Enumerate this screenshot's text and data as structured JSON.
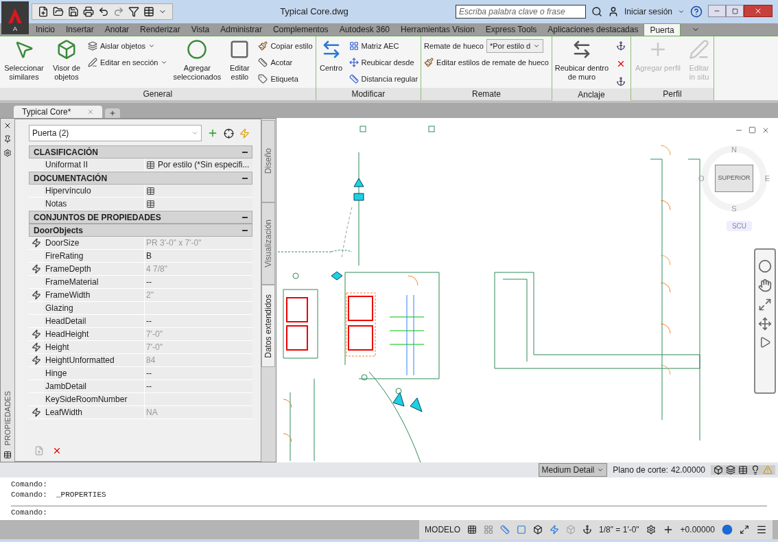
{
  "title_bar": {
    "app_button": "A",
    "title": "Typical Core.dwg",
    "search": {
      "placeholder": "Escriba palabra clave o frase"
    },
    "sign_in": "Iniciar sesión"
  },
  "ribbon_tabs": [
    {
      "label": "Inicio",
      "selected": false
    },
    {
      "label": "Insertar",
      "selected": false
    },
    {
      "label": "Anotar",
      "selected": false
    },
    {
      "label": "Renderizar",
      "selected": false
    },
    {
      "label": "Vista",
      "selected": false
    },
    {
      "label": "Administrar",
      "selected": false
    },
    {
      "label": "Complementos",
      "selected": false
    },
    {
      "label": "Autodesk 360",
      "selected": false
    },
    {
      "label": "Herramientas Vision",
      "selected": false
    },
    {
      "label": "Express Tools",
      "selected": false
    },
    {
      "label": "Aplicaciones destacadas",
      "selected": false
    },
    {
      "label": "Puerta",
      "selected": true
    }
  ],
  "ribbon_panels": [
    {
      "title": "General",
      "groups": [
        {
          "kind": "large",
          "items": [
            {
              "label": "Seleccionar similares",
              "disabled": false
            }
          ]
        },
        {
          "kind": "large",
          "items": [
            {
              "label": "Visor de objetos",
              "disabled": false
            }
          ]
        },
        {
          "kind": "small",
          "items": [
            {
              "label": "Aislar objetos",
              "dropdown": true
            },
            {
              "label": "Editar en sección",
              "dropdown": true
            }
          ]
        },
        {
          "kind": "large",
          "items": [
            {
              "label": "Agregar seleccionados",
              "disabled": false
            }
          ]
        },
        {
          "kind": "large",
          "items": [
            {
              "label": "Editar estilo",
              "disabled": false
            }
          ]
        },
        {
          "kind": "small",
          "items": [
            {
              "label": "Copiar estilo",
              "dropdown": false
            },
            {
              "label": "Acotar",
              "dropdown": false
            },
            {
              "label": "Etiqueta",
              "dropdown": false
            }
          ]
        }
      ]
    },
    {
      "title": "Modificar",
      "groups": [
        {
          "kind": "large",
          "items": [
            {
              "label": "Centro",
              "disabled": false
            }
          ]
        },
        {
          "kind": "small",
          "items": [
            {
              "label": "Matriz AEC",
              "dropdown": false
            },
            {
              "label": "Reubicar desde",
              "dropdown": false
            },
            {
              "label": "Distancia regular",
              "dropdown": false
            }
          ]
        }
      ]
    },
    {
      "title": "Remate",
      "groups": [
        {
          "kind": "combo",
          "label": "Remate de hueco",
          "value": "*Por estilo d",
          "items": [
            {
              "label": "Editar estilos de remate de hueco"
            }
          ]
        }
      ]
    },
    {
      "title": "Anclaje",
      "groups": [
        {
          "kind": "large",
          "items": [
            {
              "label": "Reubicar dentro de muro",
              "disabled": false
            }
          ]
        },
        {
          "kind": "icons",
          "items": [
            {
              "kind": "anchor"
            },
            {
              "kind": "remove"
            },
            {
              "kind": "link"
            }
          ]
        }
      ]
    },
    {
      "title": "Perfil",
      "groups": [
        {
          "kind": "large",
          "items": [
            {
              "label": "Agregar perfil",
              "disabled": true
            }
          ]
        },
        {
          "kind": "large",
          "items": [
            {
              "label": "Editar in situ",
              "disabled": true
            }
          ]
        }
      ]
    }
  ],
  "document_tabs": [
    {
      "label": "Typical Core*",
      "selected": true
    }
  ],
  "properties": {
    "palette_title": "PROPIEDADES",
    "selector": "Puerta (2)",
    "side_tabs": [
      {
        "label": "Diseño",
        "selected": false
      },
      {
        "label": "Visualización",
        "selected": false
      },
      {
        "label": "Datos extendidos",
        "selected": true
      }
    ],
    "sections": [
      {
        "title": "CLASIFICACIÓN",
        "expanded": true,
        "rows": [
          {
            "name": "Uniformat II",
            "value": "Por estilo (*Sin especifi...",
            "linked": false,
            "button": true
          }
        ]
      },
      {
        "title": "DOCUMENTACIÓN",
        "expanded": true,
        "rows": [
          {
            "name": "Hipervínculo",
            "linked": false,
            "button": true
          },
          {
            "name": "Notas",
            "linked": false,
            "button": true
          }
        ]
      },
      {
        "title": "CONJUNTOS DE PROPIEDADES",
        "expanded": true
      },
      {
        "title": "DoorObjects",
        "expanded": true,
        "rows": [
          {
            "name": "DoorSize",
            "value": "PR 3'-0\" x 7'-0\"",
            "linked": true,
            "button": false
          },
          {
            "name": "FireRating",
            "value": "B",
            "linked": false,
            "button": false
          },
          {
            "name": "FrameDepth",
            "value": "4 7/8\"",
            "linked": true,
            "button": false
          },
          {
            "name": "FrameMaterial",
            "value": "--",
            "linked": false,
            "button": false
          },
          {
            "name": "FrameWidth",
            "value": "2\"",
            "linked": true,
            "button": false
          },
          {
            "name": "Glazing",
            "linked": false,
            "button": false
          },
          {
            "name": "HeadDetail",
            "value": "--",
            "linked": false,
            "button": false
          },
          {
            "name": "HeadHeight",
            "value": "7'-0\"",
            "linked": true,
            "button": false
          },
          {
            "name": "Height",
            "value": "7'-0\"",
            "linked": true,
            "button": false
          },
          {
            "name": "HeightUnformatted",
            "value": "84",
            "linked": true,
            "button": false
          },
          {
            "name": "Hinge",
            "value": "--",
            "linked": false,
            "button": false
          },
          {
            "name": "JambDetail",
            "value": "--",
            "linked": false,
            "button": false
          },
          {
            "name": "KeySideRoomNumber",
            "linked": false,
            "button": false
          },
          {
            "name": "LeafWidth",
            "value": "NA",
            "linked": true,
            "button": false
          }
        ]
      }
    ]
  },
  "viewcube": {
    "north": "N",
    "south": "S",
    "east": "E",
    "west": "O",
    "face": "SUPERIOR",
    "ucs": "SCU"
  },
  "drawing_status": {
    "detail_level": "Medium Detail",
    "cut_plane_label": "Plano de corte:",
    "cut_plane_value": "42.00000"
  },
  "command_history": [
    "Comando:",
    "Comando:  _PROPERTIES"
  ],
  "command_prompt": "Comando:",
  "status_bar": {
    "space": "MODELO",
    "scale": "1/8\" = 1'-0\"",
    "elevation": "+0.00000"
  }
}
